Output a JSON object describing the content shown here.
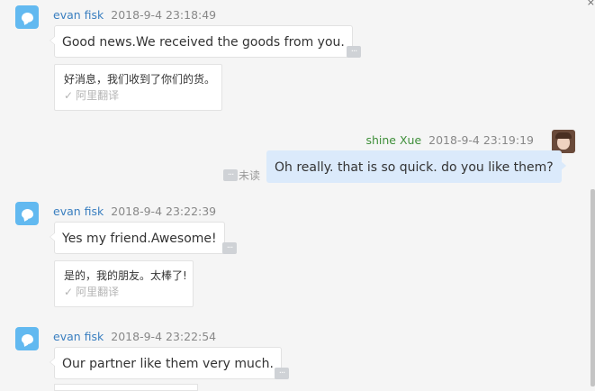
{
  "messages": [
    {
      "sender": "evan fisk",
      "time": "2018-9-4 23:18:49",
      "text": "Good news.We received the goods from you.",
      "translation": "好消息，我们收到了你们的货。",
      "translation_source": "阿里翻译"
    },
    {
      "sender": "shine Xue",
      "time": "2018-9-4 23:19:19",
      "text": "Oh really. that is so quick. do you like them?",
      "status": "未读"
    },
    {
      "sender": "evan fisk",
      "time": "2018-9-4 23:22:39",
      "text": "Yes my friend.Awesome!",
      "translation": "是的，我的朋友。太棒了!",
      "translation_source": "阿里翻译"
    },
    {
      "sender": "evan fisk",
      "time": "2018-9-4 23:22:54",
      "text": "Our partner like them very much."
    }
  ],
  "icons": {
    "avatar": "chat-bubble-icon",
    "more": "more-options-icon",
    "check": "check-icon"
  },
  "colors": {
    "incoming_name": "#3a7fc0",
    "outgoing_name": "#3f8f3a",
    "avatar_bg": "#62b9f0",
    "outgoing_bubble": "#dbeafb"
  }
}
